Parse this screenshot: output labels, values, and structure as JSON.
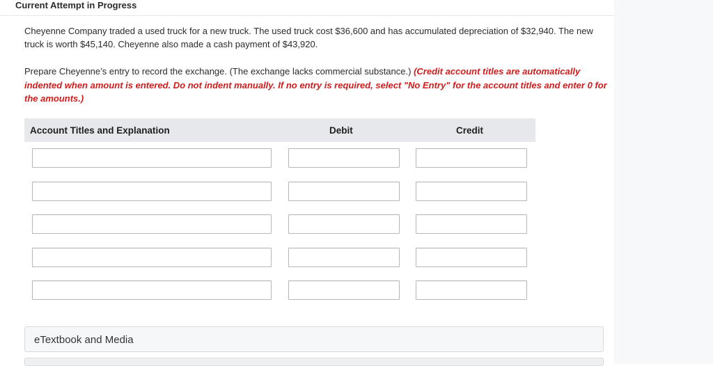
{
  "header": {
    "title": "Current Attempt in Progress"
  },
  "question": {
    "text": "Cheyenne Company traded a used truck for a new truck. The used truck cost $36,600 and has accumulated depreciation of $32,940. The new truck is worth $45,140. Cheyenne also made a cash payment of $43,920."
  },
  "instructions": {
    "prefix": "Prepare Cheyenne’s entry to record the exchange. (The exchange lacks commercial substance.) ",
    "note": "(Credit account titles are automatically indented when amount is entered. Do not indent manually. If no entry is required, select \"No Entry\" for the account titles and enter 0 for the amounts.)"
  },
  "table": {
    "headers": {
      "account": "Account Titles and Explanation",
      "debit": "Debit",
      "credit": "Credit"
    },
    "rows": [
      {
        "account": "",
        "debit": "",
        "credit": ""
      },
      {
        "account": "",
        "debit": "",
        "credit": ""
      },
      {
        "account": "",
        "debit": "",
        "credit": ""
      },
      {
        "account": "",
        "debit": "",
        "credit": ""
      },
      {
        "account": "",
        "debit": "",
        "credit": ""
      }
    ]
  },
  "resources": {
    "etextbook_label": "eTextbook and Media"
  }
}
